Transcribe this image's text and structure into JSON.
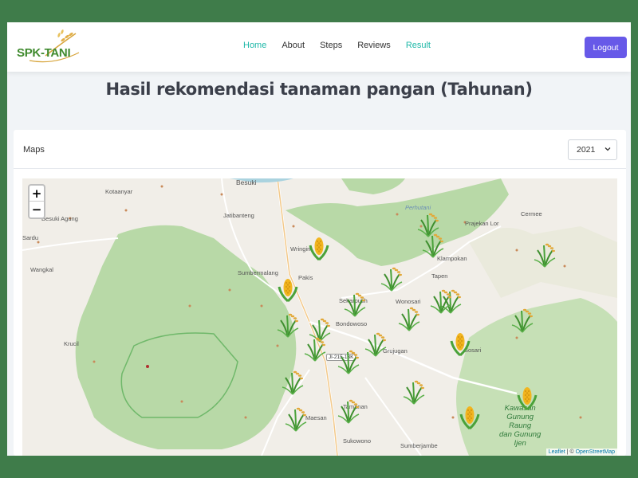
{
  "navbar": {
    "logo_text": "SPK-TANI",
    "links": [
      {
        "label": "Home",
        "active": true
      },
      {
        "label": "About",
        "active": false
      },
      {
        "label": "Steps",
        "active": false
      },
      {
        "label": "Reviews",
        "active": false
      },
      {
        "label": "Result",
        "active": true
      }
    ],
    "logout_label": "Logout"
  },
  "page": {
    "title": "Hasil rekomendasi tanaman pangan (Tahunan)"
  },
  "card": {
    "title": "Maps",
    "year_selected": "2021"
  },
  "map": {
    "zoom_in": "+",
    "zoom_out": "−",
    "places": {
      "besuki": "Besuki",
      "kotaanyar": "Kotaanyar",
      "jatibanteng": "Jatibanteng",
      "besuki_agung": "Besuki Agung",
      "sardu": "Sardu",
      "wangkal": "Wangkal",
      "sumbermalang": "Sumbermalang",
      "wringin": "Wringin",
      "pakis": "Pakis",
      "sekarputih": "Sekarputih",
      "bondowoso": "Bondowoso",
      "wonosari": "Wonosari",
      "tapen": "Tapen",
      "klampokan": "Klampokan",
      "prajekan_lor": "Prajekan Lor",
      "cermee": "Cermee",
      "perhutani": "Perhutani",
      "krucil": "Krucil",
      "grujugan": "Grujugan",
      "tamanan": "Tamanan",
      "maesan": "Maesan",
      "sukowono": "Sukowono",
      "sumberjambe": "Sumberjambe",
      "sosari": "Sosari",
      "forest_line1": "Kawasan",
      "forest_line2": "Gunung",
      "forest_line3": "Raung",
      "forest_line4": "dan Gunung",
      "forest_line5": "Ijen"
    },
    "road_label": "Jl-215-13K",
    "attribution_leaflet": "Leaflet",
    "attribution_sep": " | © ",
    "attribution_osm": "OpenStreetMap",
    "markers": [
      {
        "crop": "rice"
      },
      {
        "crop": "rice"
      },
      {
        "crop": "corn"
      },
      {
        "crop": "rice"
      },
      {
        "crop": "rice"
      },
      {
        "crop": "corn"
      },
      {
        "crop": "rice"
      },
      {
        "crop": "rice"
      },
      {
        "crop": "rice"
      },
      {
        "crop": "rice"
      },
      {
        "crop": "rice"
      },
      {
        "crop": "rice"
      },
      {
        "crop": "corn"
      },
      {
        "crop": "rice"
      },
      {
        "crop": "rice"
      },
      {
        "crop": "corn"
      },
      {
        "crop": "rice"
      },
      {
        "crop": "rice"
      },
      {
        "crop": "rice"
      },
      {
        "crop": "rice"
      },
      {
        "crop": "corn"
      },
      {
        "crop": "rice"
      },
      {
        "crop": "rice"
      }
    ]
  },
  "colors": {
    "accent_active_link": "#1fb8a8",
    "logout_button": "#6759e8",
    "page_background": "#f1f4f7",
    "outer_background": "#3f7c4a",
    "forest_green": "#a9d19a"
  }
}
